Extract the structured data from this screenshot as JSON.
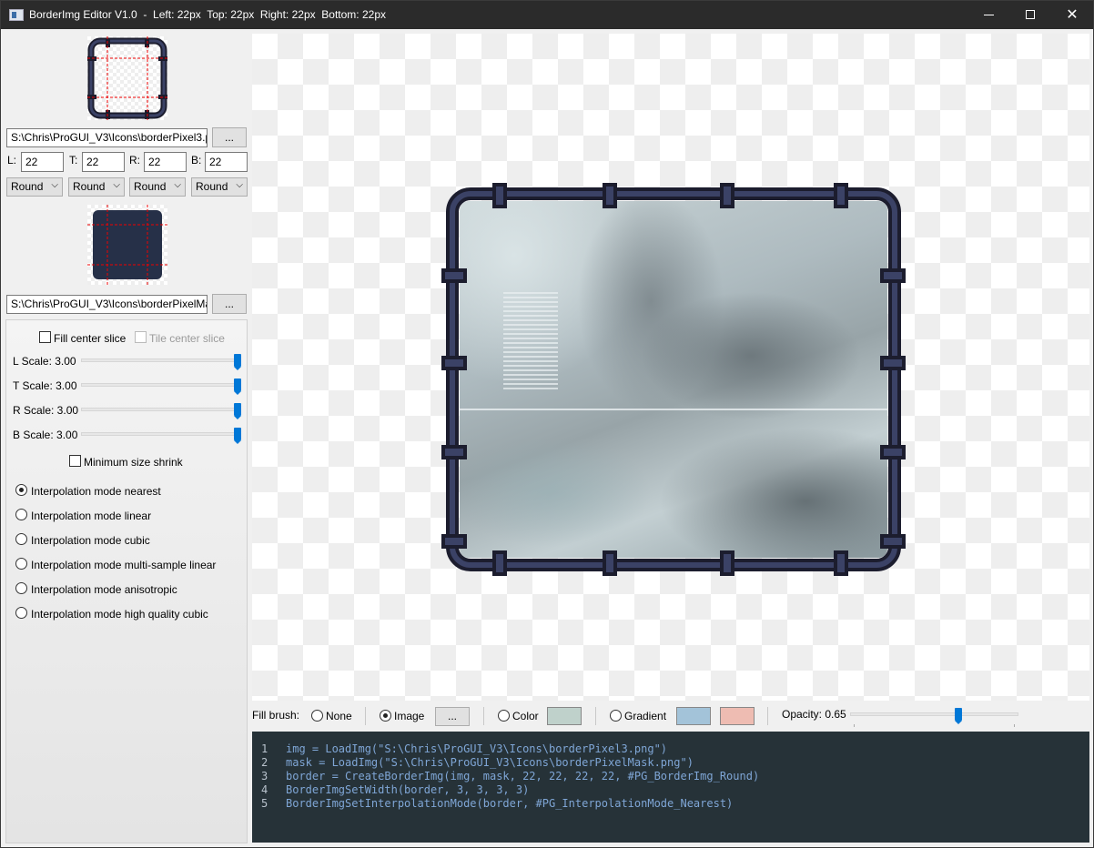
{
  "window": {
    "title": "BorderImg Editor V1.0  -  Left: 22px  Top: 22px  Right: 22px  Bottom: 22px",
    "minimize_icon": "minimize-icon",
    "maximize_icon": "maximize-icon",
    "close_icon": "close-icon"
  },
  "left_panel": {
    "image_path": "S:\\Chris\\ProGUI_V3\\Icons\\borderPixel3.png",
    "browse_label": "...",
    "mask_path": "S:\\Chris\\ProGUI_V3\\Icons\\borderPixelMask.png",
    "mask_browse_label": "...",
    "fields": [
      {
        "label": "L:",
        "value": "22"
      },
      {
        "label": "T:",
        "value": "22"
      },
      {
        "label": "R:",
        "value": "22"
      },
      {
        "label": "B:",
        "value": "22"
      }
    ],
    "modes": [
      "Round",
      "Round",
      "Round",
      "Round"
    ],
    "fill_center_label": "Fill center slice",
    "fill_center_checked": false,
    "tile_center_label": "Tile center slice",
    "tile_center_checked": false,
    "scales": [
      {
        "label": "L Scale: 3.00",
        "value": 3.0,
        "fraction": 1.0
      },
      {
        "label": "T Scale: 3.00",
        "value": 3.0,
        "fraction": 1.0
      },
      {
        "label": "R Scale: 3.00",
        "value": 3.0,
        "fraction": 1.0
      },
      {
        "label": "B Scale: 3.00",
        "value": 3.0,
        "fraction": 1.0
      }
    ],
    "min_size_shrink_label": "Minimum size shrink",
    "min_size_shrink_checked": false,
    "interpolation_modes": [
      {
        "label": "Interpolation mode nearest",
        "selected": true
      },
      {
        "label": "Interpolation mode linear",
        "selected": false
      },
      {
        "label": "Interpolation mode cubic",
        "selected": false
      },
      {
        "label": "Interpolation mode multi-sample linear",
        "selected": false
      },
      {
        "label": "Interpolation mode anisotropic",
        "selected": false
      },
      {
        "label": "Interpolation mode high quality cubic",
        "selected": false
      }
    ]
  },
  "fill_brush": {
    "label": "Fill brush:",
    "none_label": "None",
    "image_label": "Image",
    "image_browse_label": "...",
    "color_label": "Color",
    "color_value": "#bfd1cb",
    "gradient_label": "Gradient",
    "gradient_color_1": "#a3c3d9",
    "gradient_color_2": "#eebcb2",
    "selected": "Image",
    "opacity_label": "Opacity: 0.65",
    "opacity_value": 0.65
  },
  "code": {
    "lines": [
      {
        "num": "1",
        "text": "img = LoadImg(\"S:\\Chris\\ProGUI_V3\\Icons\\borderPixel3.png\")"
      },
      {
        "num": "2",
        "text": "mask = LoadImg(\"S:\\Chris\\ProGUI_V3\\Icons\\borderPixelMask.png\")"
      },
      {
        "num": "3",
        "text": "border = CreateBorderImg(img, mask, 22, 22, 22, 22, #PG_BorderImg_Round)"
      },
      {
        "num": "4",
        "text": "BorderImgSetWidth(border, 3, 3, 3, 3)"
      },
      {
        "num": "5",
        "text": "BorderImgSetInterpolationMode(border, #PG_InterpolationMode_Nearest)"
      }
    ]
  },
  "colors": {
    "frame_dark": "#1c1d2e",
    "frame_light": "#3b4266",
    "code_bg": "#263238",
    "accent": "#0078d7"
  }
}
